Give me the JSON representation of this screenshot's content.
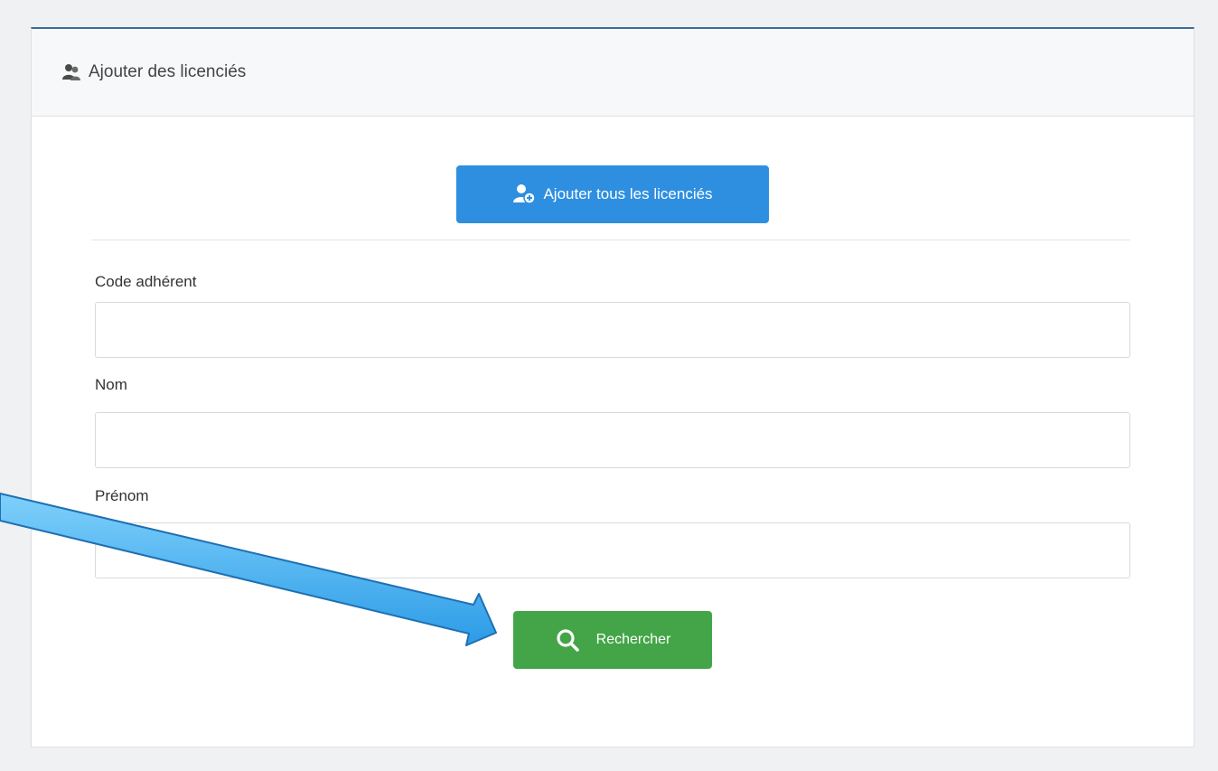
{
  "panel": {
    "title": "Ajouter des licenciés",
    "title_icon": "users-icon"
  },
  "actions": {
    "add_all_label": "Ajouter tous les licenciés",
    "add_all_icon": "user-add-icon",
    "search_label": "Rechercher",
    "search_icon": "search-icon"
  },
  "form": {
    "code_label": "Code adhérent",
    "code_value": "",
    "nom_label": "Nom",
    "nom_value": "",
    "prenom_label": "Prénom",
    "prenom_value": ""
  },
  "colors": {
    "primary": "#2e8fe0",
    "success": "#43a547",
    "header_border": "#3c6c9a",
    "annotation_arrow": "#3aa8ee"
  },
  "annotation": {
    "type": "arrow",
    "target": "search-button"
  }
}
